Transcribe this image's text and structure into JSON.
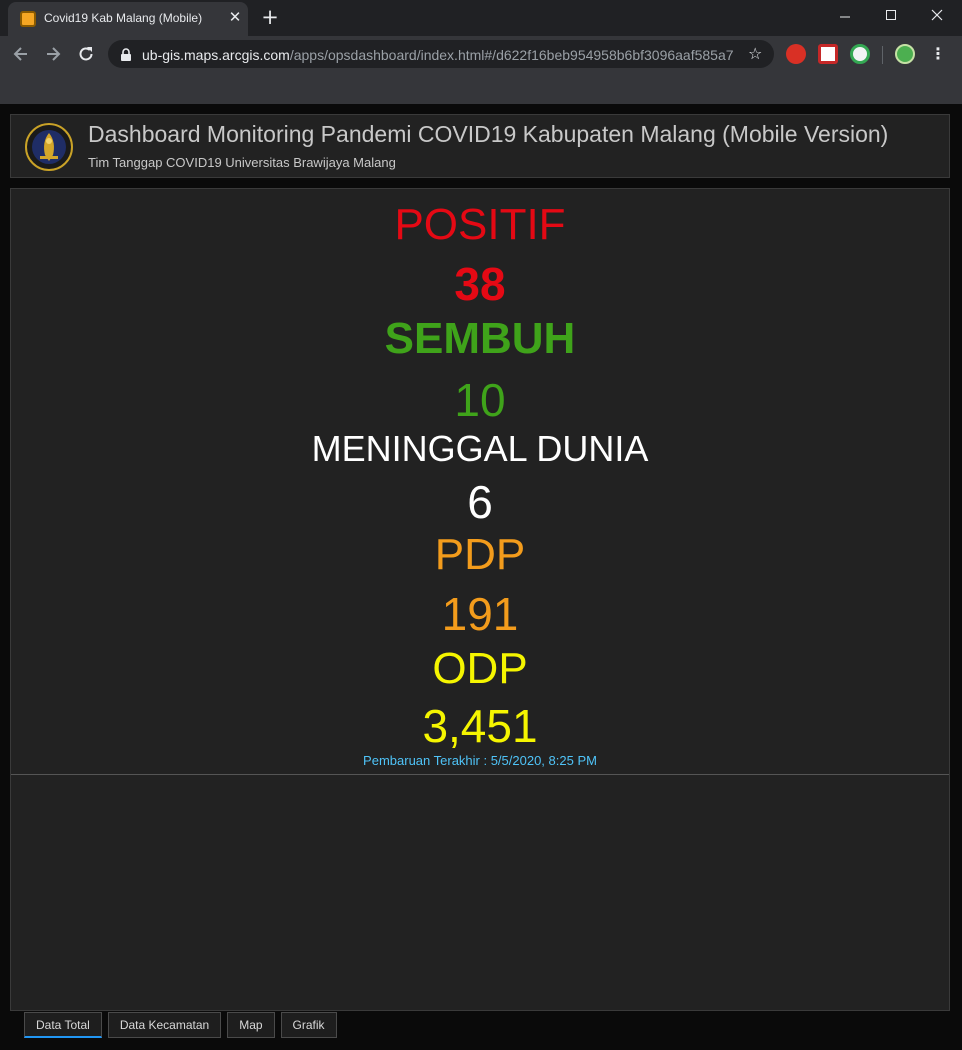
{
  "browser": {
    "tab_title": "Covid19 Kab Malang (Mobile)",
    "url_host": "ub-gis.maps.arcgis.com",
    "url_path": "/apps/opsdashboard/index.html#/d622f16beb954958b6bf3096aaf585a7"
  },
  "header": {
    "title": "Dashboard Monitoring Pandemi COVID19 Kabupaten Malang (Mobile Version)",
    "subtitle": "Tim Tanggap COVID19 Universitas Brawijaya Malang"
  },
  "stats": {
    "positif_label": "POSITIF",
    "positif_value": "38",
    "sembuh_label": "SEMBUH",
    "sembuh_value": "10",
    "meninggal_label": "MENINGGAL DUNIA",
    "meninggal_value": "6",
    "pdp_label": "PDP",
    "pdp_value": "191",
    "odp_label": "ODP",
    "odp_value": "3,451",
    "updated": "Pembaruan Terakhir : 5/5/2020, 8:25 PM"
  },
  "colors": {
    "positif": "#e50914",
    "sembuh": "#3fa31a",
    "meninggal": "#ffffff",
    "pdp": "#f39c1c",
    "odp": "#f5f500",
    "updated": "#4fc3f7",
    "active_tab": "#2196f3"
  },
  "tabs": {
    "data_total": "Data Total",
    "data_kecamatan": "Data Kecamatan",
    "map": "Map",
    "grafik": "Grafik"
  },
  "icons": {
    "back": "arrow-left-icon",
    "forward": "arrow-right-icon",
    "reload": "reload-icon",
    "lock": "lock-icon",
    "star": "star-icon",
    "menu": "kebab-menu-icon"
  }
}
